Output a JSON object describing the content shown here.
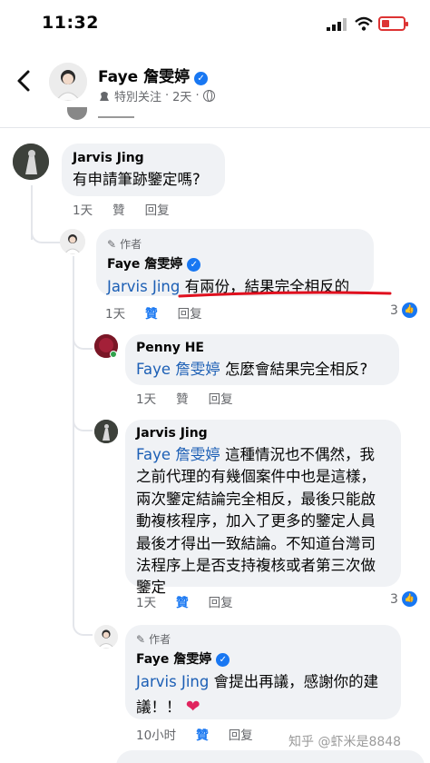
{
  "status_bar": {
    "time": "11:32"
  },
  "header": {
    "name": "Faye 詹雯婷",
    "follow_label": "特別关注",
    "time": "2天",
    "separator": "·"
  },
  "comments": [
    {
      "id": "c1",
      "name": "Jarvis Jing",
      "text": "有申請筆跡鑒定嗎?",
      "time": "1天",
      "like": "贊",
      "reply": "回复"
    },
    {
      "id": "c2",
      "author_tag": "作者",
      "name": "Faye 詹雯婷",
      "mention": "Jarvis Jing",
      "text": " 有兩份，結果完全相反的",
      "time": "1天",
      "like": "贊",
      "reply": "回复",
      "reactions": "3"
    },
    {
      "id": "c3",
      "name": "Penny HE",
      "mention": "Faye 詹雯婷",
      "text": " 怎麼會結果完全相反?",
      "time": "1天",
      "like": "贊",
      "reply": "回复"
    },
    {
      "id": "c4",
      "name": "Jarvis Jing",
      "mention": "Faye 詹雯婷",
      "lines": [
        " 這種情況也不偶然，我",
        "之前代理的有幾個案件中也是這樣，",
        "兩次鑒定結論完全相反，最後只能啟",
        "動複核程序，加入了更多的鑒定人員",
        "最後才得出一致結論。不知道台灣司",
        "法程序上是否支持複核或者第三次做",
        "鑒定"
      ],
      "time": "1天",
      "like": "贊",
      "reply": "回复",
      "reactions": "3"
    },
    {
      "id": "c5",
      "author_tag": "作者",
      "name": "Faye 詹雯婷",
      "mention": "Jarvis Jing",
      "line1": " 會提出再議，感謝你的建",
      "line2": "議！！",
      "time": "10小时",
      "like": "贊",
      "reply": "回复"
    }
  ],
  "watermark": "知乎 @虾米是8848",
  "colors": {
    "link": "#1c5fb5",
    "like_blue": "#1877f2",
    "bubble": "#f0f2f5",
    "underline": "#e0101e",
    "heart": "#e0245e"
  },
  "icons": [
    "back-arrow-icon",
    "verified-badge-icon",
    "globe-icon",
    "pen-icon",
    "like-reaction-icon",
    "heart-emoji-icon"
  ]
}
